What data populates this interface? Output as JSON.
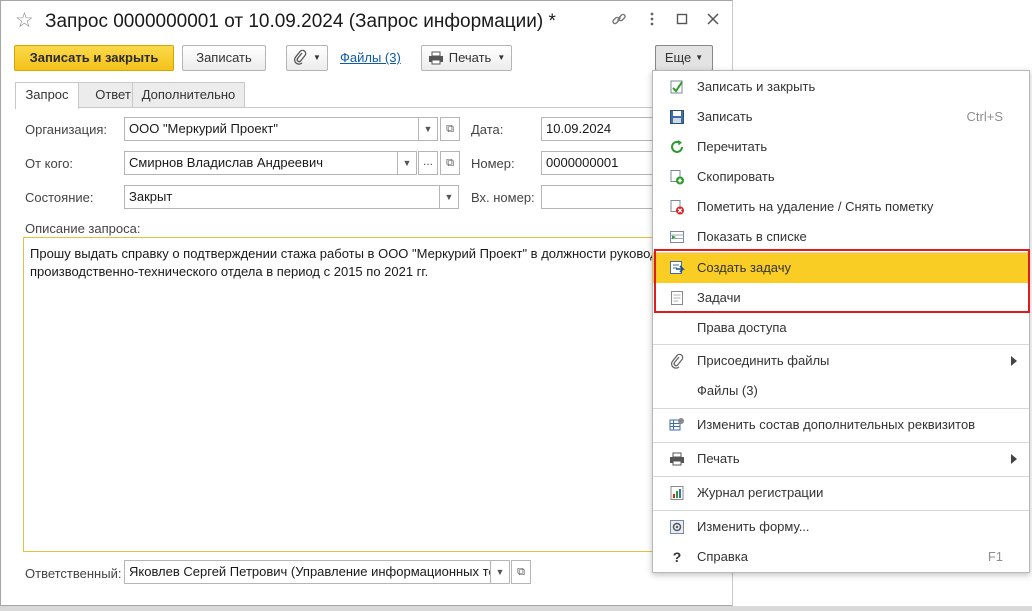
{
  "window": {
    "title": "Запрос 0000000001 от 10.09.2024 (Запрос информации) *"
  },
  "toolbar": {
    "save_close_label": "Записать и закрыть",
    "save_label": "Записать",
    "files_link": "Файлы (3)",
    "print_label": "Печать",
    "more_label": "Еще"
  },
  "tabs": [
    {
      "label": "Запрос",
      "active": true
    },
    {
      "label": "Ответ",
      "active": false
    },
    {
      "label": "Дополнительно",
      "active": false
    }
  ],
  "form": {
    "organization_label": "Организация:",
    "organization_value": "ООО \"Меркурий Проект\"",
    "from_label": "От кого:",
    "from_value": "Смирнов Владислав Андреевич",
    "state_label": "Состояние:",
    "state_value": "Закрыт",
    "date_label": "Дата:",
    "date_value": "10.09.2024",
    "number_label": "Номер:",
    "number_value": "0000000001",
    "in_number_label": "Вх. номер:",
    "in_number_value": "",
    "description_label": "Описание запроса:",
    "description_line1": "Прошу выдать справку о подтверждении стажа работы в ООО \"Меркурий Проект\" в должности руковод",
    "description_line2": "производственно-технического отдела в период с 2015 по 2021 гг.",
    "responsible_label": "Ответственный:",
    "responsible_value": "Яковлев Сергей Петрович (Управление информационных те:"
  },
  "menu": {
    "items": [
      {
        "label": "Записать и закрыть",
        "icon": "save-close-icon"
      },
      {
        "label": "Записать",
        "shortcut": "Ctrl+S",
        "icon": "floppy-icon"
      },
      {
        "label": "Перечитать",
        "icon": "refresh-icon"
      },
      {
        "label": "Скопировать",
        "icon": "copy-icon"
      },
      {
        "label": "Пометить на удаление / Снять пометку",
        "icon": "delete-mark-icon"
      },
      {
        "label": "Показать в списке",
        "icon": "show-in-list-icon"
      },
      {
        "label": "Создать задачу",
        "icon": "create-task-icon",
        "highlighted": true
      },
      {
        "label": "Задачи",
        "icon": "tasks-icon"
      },
      {
        "label": "Права доступа",
        "icon": ""
      },
      {
        "label": "Присоединить файлы",
        "icon": "paperclip-icon",
        "submenu": true
      },
      {
        "label": "Файлы (3)",
        "icon": ""
      },
      {
        "label": "Изменить состав дополнительных реквизитов",
        "icon": "attributes-icon"
      },
      {
        "label": "Печать",
        "icon": "printer-icon",
        "submenu": true
      },
      {
        "label": "Журнал регистрации",
        "icon": "event-log-icon"
      },
      {
        "label": "Изменить форму...",
        "icon": "form-settings-icon"
      },
      {
        "label": "Справка",
        "shortcut": "F1",
        "icon": "help-icon"
      }
    ]
  },
  "colors": {
    "accent_yellow": "#f9cd24",
    "link_blue": "#0f5aa7",
    "highlight_red": "#e01b1b"
  }
}
